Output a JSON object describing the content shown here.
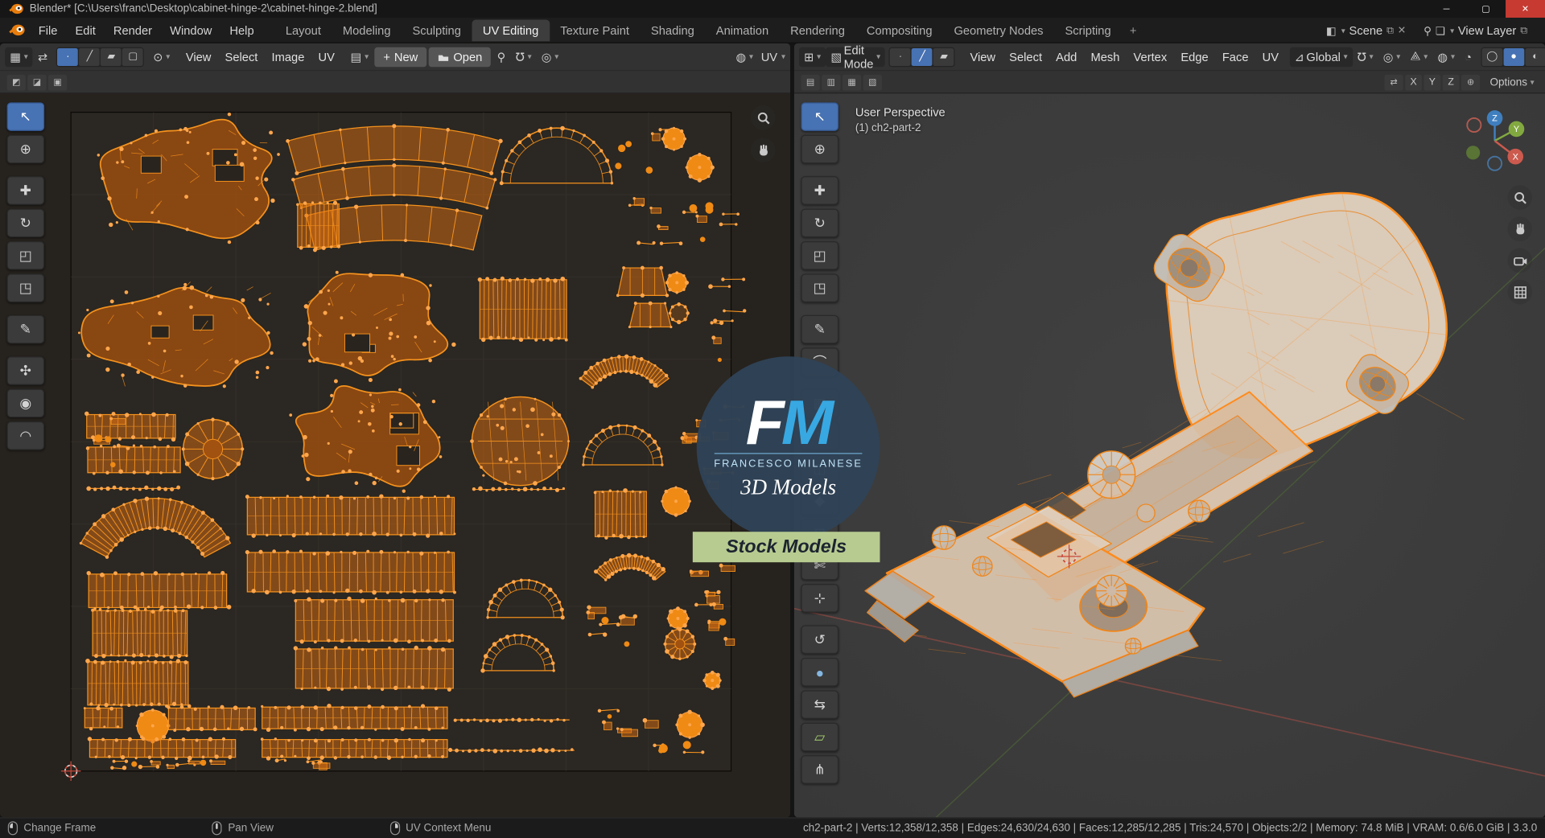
{
  "titlebar": {
    "title": "Blender* [C:\\Users\\franc\\Desktop\\cabinet-hinge-2\\cabinet-hinge-2.blend]",
    "controls": {
      "minimize": "─",
      "maximize": "▢",
      "close": "✕"
    }
  },
  "menubar": {
    "menus": [
      "File",
      "Edit",
      "Render",
      "Window",
      "Help"
    ],
    "workspaces": [
      "Layout",
      "Modeling",
      "Sculpting",
      "UV Editing",
      "Texture Paint",
      "Shading",
      "Animation",
      "Rendering",
      "Compositing",
      "Geometry Nodes",
      "Scripting"
    ],
    "active_workspace": "UV Editing",
    "new_workspace": "+",
    "scene_label": "Scene",
    "view_layer_label": "View Layer"
  },
  "uv_editor": {
    "selection_modes": [
      {
        "name": "vertex",
        "glyph": "∙",
        "active": true
      },
      {
        "name": "edge",
        "glyph": "╱"
      },
      {
        "name": "face",
        "glyph": "▰"
      },
      {
        "name": "island",
        "glyph": "▢"
      }
    ],
    "menus": [
      "View",
      "Select",
      "Image",
      "UV"
    ],
    "new_label": "New",
    "open_label": "Open",
    "right_label": "UV",
    "tools": [
      {
        "name": "tweak-select",
        "glyph": "↖",
        "active": true
      },
      {
        "name": "cursor-2d",
        "glyph": "⊕"
      },
      {
        "name": "move",
        "glyph": "✚",
        "gap": true
      },
      {
        "name": "rotate",
        "glyph": "↻"
      },
      {
        "name": "scale",
        "glyph": "◰"
      },
      {
        "name": "transform",
        "glyph": "◳"
      },
      {
        "name": "annotate",
        "glyph": "✎",
        "gap": true
      },
      {
        "name": "grab",
        "glyph": "✣",
        "gap": true
      },
      {
        "name": "relax",
        "glyph": "◉"
      },
      {
        "name": "pinch",
        "glyph": "◠"
      }
    ]
  },
  "viewport": {
    "mode": "Edit Mode",
    "selection_modes": [
      {
        "name": "vertex",
        "glyph": "∙"
      },
      {
        "name": "edge",
        "glyph": "╱",
        "active": true
      },
      {
        "name": "face",
        "glyph": "▰"
      }
    ],
    "menus": [
      "View",
      "Select",
      "Add",
      "Mesh",
      "Vertex",
      "Edge",
      "Face",
      "UV"
    ],
    "orientation": "Global",
    "options_label": "Options",
    "axes": [
      "X",
      "Y",
      "Z"
    ],
    "overlay": {
      "perspective": "User Perspective",
      "object": "(1) ch2-part-2"
    },
    "gizmo": {
      "x": "X",
      "y": "Y",
      "z": "Z"
    },
    "tools": [
      {
        "name": "tweak-select",
        "glyph": "↖",
        "active": true
      },
      {
        "name": "cursor-3d",
        "glyph": "⊕"
      },
      {
        "name": "move",
        "glyph": "✚",
        "gap": true
      },
      {
        "name": "rotate",
        "glyph": "↻"
      },
      {
        "name": "scale",
        "glyph": "◰"
      },
      {
        "name": "transform",
        "glyph": "◳"
      },
      {
        "name": "annotate",
        "glyph": "✎",
        "gap": true
      },
      {
        "name": "measure",
        "glyph": "⌒"
      },
      {
        "name": "add-cube",
        "glyph": "▦",
        "gap": true
      },
      {
        "name": "extrude-region",
        "glyph": "⇧"
      },
      {
        "name": "inset-faces",
        "glyph": "◫"
      },
      {
        "name": "bevel",
        "glyph": "◆"
      },
      {
        "name": "loop-cut",
        "glyph": "⊟"
      },
      {
        "name": "knife",
        "glyph": "✄"
      },
      {
        "name": "poly-build",
        "glyph": "⊹"
      },
      {
        "name": "spin",
        "glyph": "↺",
        "gap": true
      },
      {
        "name": "smooth",
        "glyph": "●",
        "color": "#84b7e2"
      },
      {
        "name": "edge-slide",
        "glyph": "⇆"
      },
      {
        "name": "shear",
        "glyph": "▱",
        "color": "#a3cf6b"
      },
      {
        "name": "rip-region",
        "glyph": "⋔"
      }
    ]
  },
  "statusbar": {
    "hints": [
      {
        "icon": "left",
        "label": "Change Frame"
      },
      {
        "icon": "middle",
        "label": "Pan View"
      },
      {
        "icon": "right",
        "label": "UV Context Menu"
      }
    ],
    "stats": "ch2-part-2 | Verts:12,358/12,358 | Edges:24,630/24,630 | Faces:12,285/12,285 | Tris:24,570 | Objects:2/2 | Memory: 74.8 MiB | VRAM: 0.6/6.0 GiB | 3.3.0"
  },
  "watermark": {
    "f": "F",
    "m": "M",
    "name": "FRANCESCO MILANESE",
    "tagline": "3D Models",
    "banner": "Stock Models"
  },
  "colors": {
    "accent": "#4772b3",
    "selection_orange": "#f5921d",
    "vertex_dot": "#ffa64c",
    "close_red": "#c63a31",
    "gizmo_x": "#cc5a4e",
    "gizmo_y": "#82a93f",
    "gizmo_z": "#3f7fbf",
    "banner_bg": "#b7cb90",
    "logo_blue": "#38a8e2"
  },
  "uv_islands": [
    [
      "blob",
      190,
      181,
      200,
      126
    ],
    [
      "arc",
      400,
      520,
      392,
      34,
      -106,
      -74
    ],
    [
      "arc",
      400,
      540,
      372,
      30,
      -106,
      -74
    ],
    [
      "arc",
      400,
      576,
      368,
      36,
      -104,
      -76
    ],
    [
      "ladd",
      323,
      229,
      42,
      44
    ],
    [
      "dome",
      565,
      186,
      56
    ],
    [
      "bits",
      624,
      122,
      48,
      126,
      12
    ],
    [
      "disc",
      684,
      141,
      11
    ],
    [
      "disc",
      710,
      170,
      13
    ],
    [
      "bits",
      688,
      198,
      50,
      50,
      8
    ],
    [
      "blob",
      188,
      338,
      198,
      112
    ],
    [
      "blob",
      376,
      328,
      166,
      104
    ],
    [
      "ladd",
      531,
      314,
      88,
      60
    ],
    [
      "trap",
      652,
      286,
      50,
      28
    ],
    [
      "trap",
      660,
      320,
      42,
      24
    ],
    [
      "disc",
      687,
      287,
      10
    ],
    [
      "ring",
      689,
      318,
      9
    ],
    [
      "bits",
      712,
      282,
      28,
      66,
      6
    ],
    [
      "lad",
      133,
      433,
      90,
      24
    ],
    [
      "lad",
      136,
      467,
      94,
      26
    ],
    [
      "gear",
      216,
      456,
      30
    ],
    [
      "bits",
      91,
      424,
      36,
      60,
      6
    ],
    [
      "dotrow",
      136,
      496,
      92
    ],
    [
      "blob",
      376,
      444,
      164,
      110
    ],
    [
      "hex",
      528,
      448,
      98,
      90
    ],
    [
      "arc",
      634,
      418,
      56,
      15,
      -143,
      -37
    ],
    [
      "dome",
      632,
      472,
      40
    ],
    [
      "bits",
      686,
      362,
      54,
      128,
      12
    ],
    [
      "arc",
      158,
      592,
      86,
      30,
      -152,
      -28
    ],
    [
      "lad",
      356,
      524,
      210,
      38
    ],
    [
      "lad",
      356,
      581,
      210,
      40
    ],
    [
      "lad",
      160,
      600,
      140,
      34
    ],
    [
      "dotrow",
      527,
      497,
      92
    ],
    [
      "ladd",
      630,
      522,
      52,
      46
    ],
    [
      "disc",
      686,
      509,
      14
    ],
    [
      "arc",
      640,
      610,
      46,
      13,
      -140,
      -40
    ],
    [
      "bits",
      690,
      562,
      46,
      56,
      7
    ],
    [
      "ladd",
      142,
      643,
      96,
      46
    ],
    [
      "lad",
      380,
      630,
      160,
      42
    ],
    [
      "dome",
      533,
      627,
      38
    ],
    [
      "bits",
      584,
      600,
      64,
      56,
      8
    ],
    [
      "disc",
      688,
      628,
      10
    ],
    [
      "bits",
      714,
      610,
      26,
      42,
      5
    ],
    [
      "ladd",
      140,
      694,
      102,
      44
    ],
    [
      "lad",
      380,
      679,
      160,
      40
    ],
    [
      "dome",
      526,
      681,
      36
    ],
    [
      "gear",
      690,
      654,
      15
    ],
    [
      "disc",
      723,
      691,
      8
    ],
    [
      "lad",
      105,
      729,
      38,
      20
    ],
    [
      "disc",
      155,
      737,
      16
    ],
    [
      "lad",
      215,
      730,
      88,
      22
    ],
    [
      "lad",
      360,
      729,
      188,
      22
    ],
    [
      "dotrow",
      520,
      731,
      116
    ],
    [
      "bits",
      600,
      716,
      60,
      32,
      6
    ],
    [
      "disc",
      700,
      736,
      13
    ],
    [
      "lad",
      165,
      760,
      148,
      18
    ],
    [
      "lad",
      360,
      760,
      188,
      18
    ],
    [
      "dotrow",
      520,
      762,
      126
    ],
    [
      "bits",
      646,
      754,
      70,
      18,
      5
    ],
    [
      "bits",
      92,
      772,
      300,
      8,
      14
    ]
  ]
}
